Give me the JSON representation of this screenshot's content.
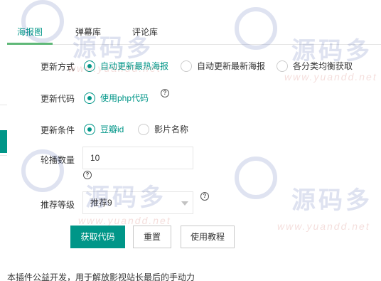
{
  "tabs": [
    {
      "label": "海报图",
      "active": true
    },
    {
      "label": "弹幕库",
      "active": false
    },
    {
      "label": "评论库",
      "active": false
    }
  ],
  "form": {
    "update_mode": {
      "label": "更新方式",
      "options": [
        "自动更新最热海报",
        "自动更新最新海报",
        "各分类均衡获取"
      ],
      "selected": 0
    },
    "update_code": {
      "label": "更新代码",
      "options": [
        "使用php代码"
      ],
      "selected": 0,
      "help": "?"
    },
    "update_condition": {
      "label": "更新条件",
      "options": [
        "豆瓣id",
        "影片名称"
      ],
      "selected": 0
    },
    "carousel_count": {
      "label": "轮播数量",
      "value": "10",
      "help": "?"
    },
    "recommend_level": {
      "label": "推荐等级",
      "value": "推荐9",
      "help": "?"
    }
  },
  "buttons": {
    "get_code": "获取代码",
    "reset": "重置",
    "tutorial": "使用教程"
  },
  "footer": {
    "note": "本插件公益开发，用于解放影视站长最后的手动力"
  },
  "watermark": {
    "text": "源码多",
    "url": "www.yuandd.net"
  },
  "colors": {
    "primary": "#009688",
    "tab_underline": "#5fb878",
    "border": "#e6e6e6"
  }
}
